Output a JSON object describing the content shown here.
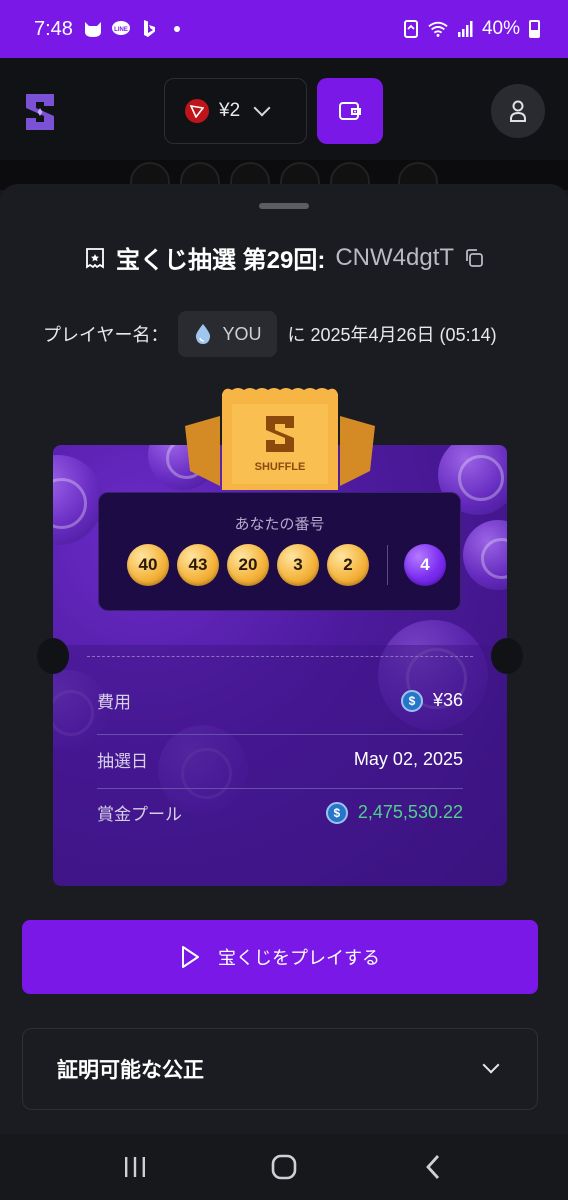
{
  "status_bar": {
    "time": "7:48",
    "battery": "40%",
    "icons": [
      "cat-icon",
      "line-icon",
      "bing-icon",
      "dot-icon",
      "recycle-icon",
      "wifi-icon",
      "signal-icon",
      "battery-icon"
    ]
  },
  "header": {
    "currency_amount": "¥2",
    "currency_icon": "tron-icon"
  },
  "sheet": {
    "title_bold": "宝くじ抽選 第29回:",
    "title_code": "CNW4dgtT",
    "player_label": "プレイヤー名：",
    "player_name": "YOU",
    "date_text": "に 2025年4月26日 (05:14)"
  },
  "ticket": {
    "brand": "SHUFFLE",
    "numbers_label": "あなたの番号",
    "numbers": [
      "40",
      "43",
      "20",
      "3",
      "2"
    ],
    "bonus": "4",
    "rows": [
      {
        "key": "費用",
        "value": "¥36"
      },
      {
        "key": "抽選日",
        "value": "May 02, 2025"
      },
      {
        "key": "賞金プール",
        "value": "2,475,530.22"
      }
    ]
  },
  "actions": {
    "play_label": "宝くじをプレイする",
    "fair_label": "証明可能な公正"
  },
  "colors": {
    "accent": "#7a18e8",
    "background": "#17181c",
    "sheet": "#1b1c21",
    "ball_gold": "#f5b53f",
    "prize_green": "#4fd08c"
  }
}
